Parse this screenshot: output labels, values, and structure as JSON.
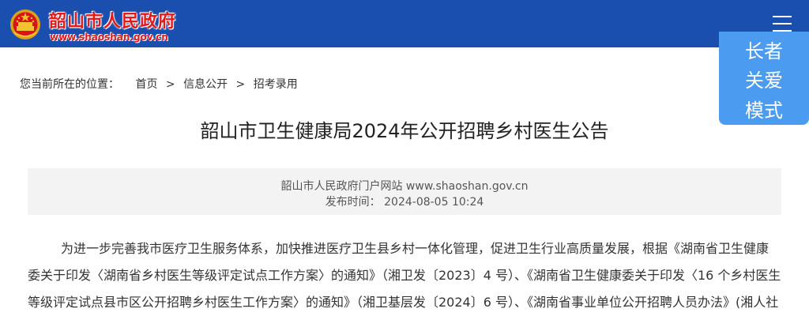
{
  "header": {
    "site_name": "韶山市人民政府",
    "site_url": "www.shaoshan.gov.cn",
    "emblem_icon": "national-emblem-icon",
    "menu_icon": "hamburger-menu-icon",
    "background_color": "#1a4fb0"
  },
  "elder_mode": {
    "line1": "长者",
    "line2": "关爱",
    "line3": "模式",
    "background_color": "#4b9cf0"
  },
  "breadcrumb": {
    "lead": "您当前所在的位置：",
    "items": [
      "首页",
      "信息公开",
      "招考录用"
    ],
    "separator": ">"
  },
  "article": {
    "title": "韶山市卫生健康局2024年公开招聘乡村医生公告",
    "source": "韶山市人民政府门户网站 www.shaoshan.gov.cn",
    "publish_time": "发布时间：  2024-08-05 10:24",
    "body_lines": [
      "为进一步完善我市医疗卫生服务体系，加快推进医疗卫生县乡村一体化管理，促进卫生行业高质量发展，根据《湖南省卫生健康",
      "委关于印发〈湖南省乡村医生等级评定试点工作方案〉的通知》（湘卫发〔2023〕4 号）、《湖南省卫生健康委关于印发〈16 个乡村医生",
      "等级评定试点县市区公开招聘乡村医生工作方案〉的通知》（湘卫基层发〔2024〕6 号）、《湖南省事业单位公开招聘人员办法》(湘人社"
    ]
  }
}
